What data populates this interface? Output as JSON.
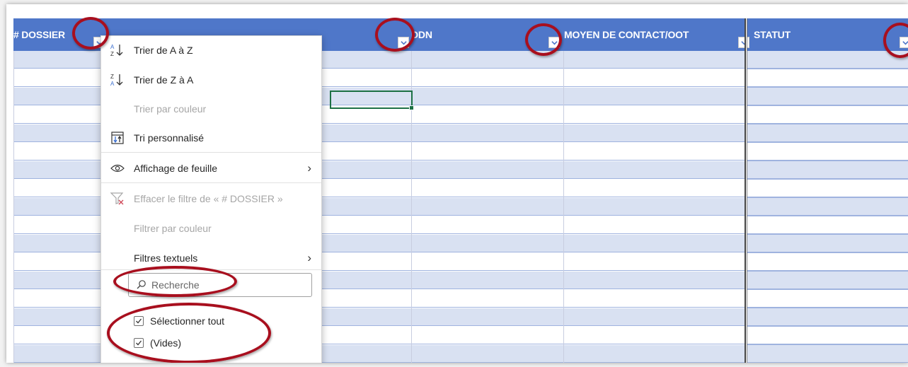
{
  "headers": {
    "dossier": "# DOSSIER",
    "ddn": "DDN",
    "moyen": "MOYEN DE CONTACT/OOT",
    "statut": "STATUT"
  },
  "menu": {
    "sort_az": "Trier de A à Z",
    "sort_za": "Trier de Z à A",
    "sort_color": "Trier par couleur",
    "custom_sort": "Tri personnalisé",
    "sheet_view": "Affichage de feuille",
    "clear_filter": "Effacer le filtre de « # DOSSIER »",
    "filter_color": "Filtrer par couleur",
    "text_filters": "Filtres textuels",
    "search_placeholder": "Recherche",
    "select_all": "Sélectionner tout",
    "blanks": "(Vides)"
  },
  "checkbox_states": {
    "select_all": true,
    "blanks": true
  },
  "colors": {
    "header_blue": "#4f77c9",
    "band_blue": "#d9e1f2",
    "statut_peach": "#fce4d6",
    "annotation_red": "#a80f1e",
    "active_cell_green": "#1e7145"
  },
  "icons": [
    "sort-az-icon",
    "sort-za-icon",
    "custom-sort-icon",
    "eye-icon",
    "clear-filter-icon",
    "search-icon",
    "chevron-right-icon",
    "dropdown-arrow-icon",
    "checkbox-icon"
  ]
}
